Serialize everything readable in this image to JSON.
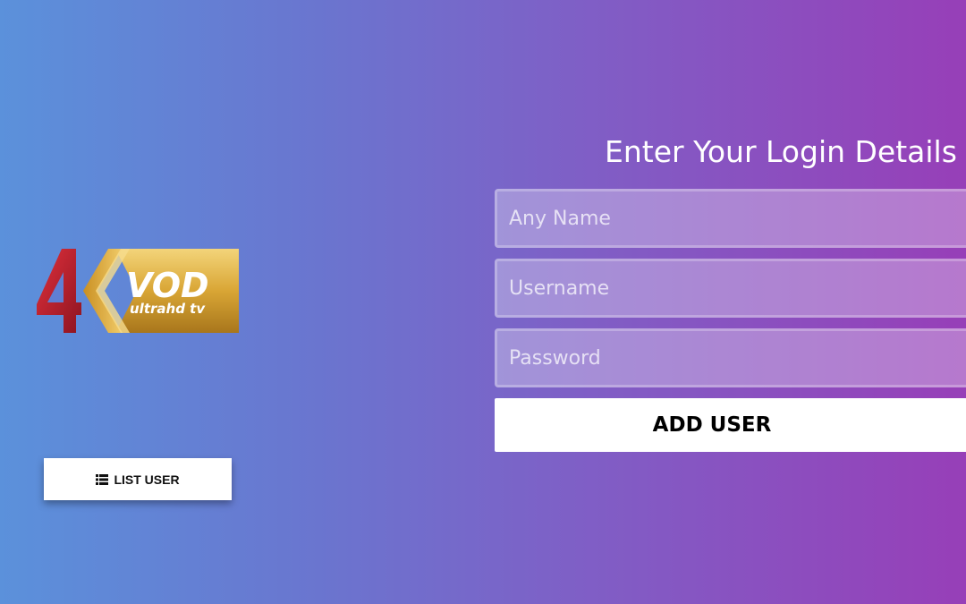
{
  "logo": {
    "big_text": "4K",
    "brand": "VOD",
    "tagline": "ultrahd tv"
  },
  "sidebar": {
    "list_user_label": "LIST USER",
    "list_user_icon": "list-icon"
  },
  "login": {
    "title": "Enter Your Login Details",
    "name_placeholder": "Any Name",
    "username_placeholder": "Username",
    "password_placeholder": "Password",
    "submit_label": "ADD USER"
  },
  "colors": {
    "gradient_left": "#5b91db",
    "gradient_right": "#973fb8",
    "logo_red": "#c0202e",
    "logo_gold": "#d9a635"
  }
}
